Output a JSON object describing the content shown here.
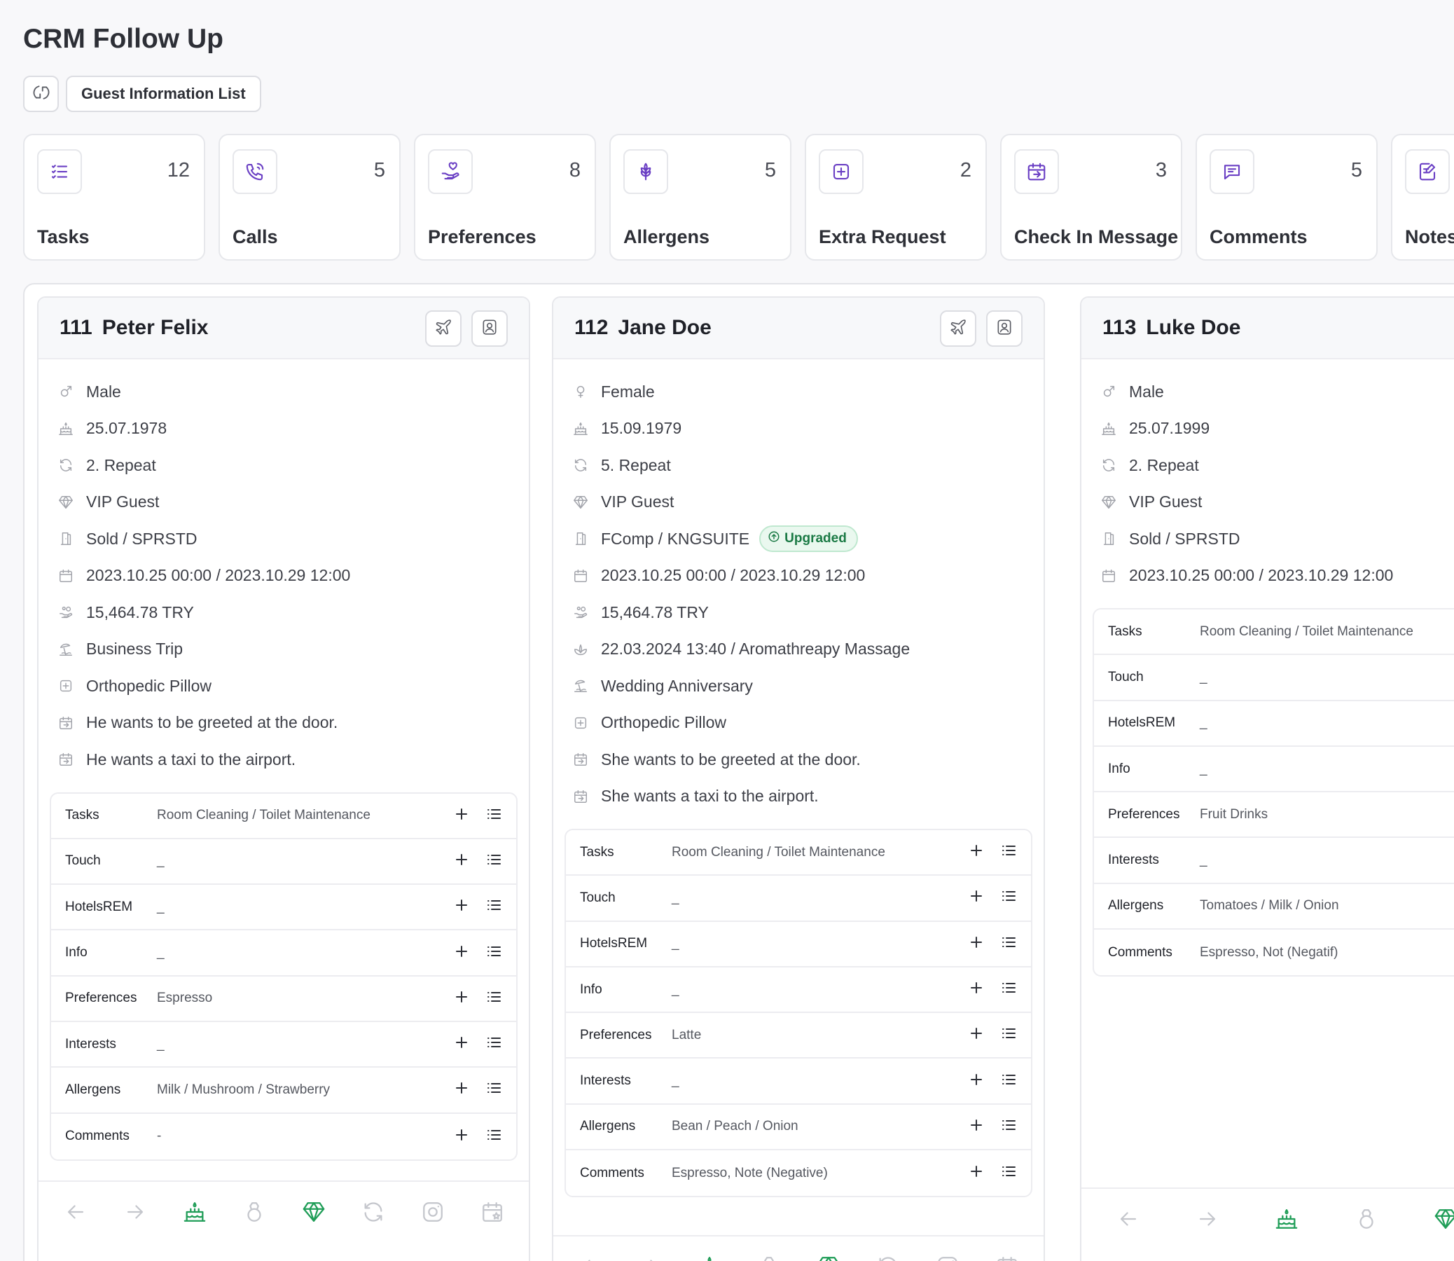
{
  "page": {
    "title": "CRM Follow Up"
  },
  "toolbar": {
    "list_button": "Guest Information List"
  },
  "colors": {
    "accent": "#6a3fc4",
    "green": "#1f9d57",
    "muted_icon": "#a2a4ab"
  },
  "stats": [
    {
      "label": "Tasks",
      "count": "12",
      "icon": "list-icon"
    },
    {
      "label": "Calls",
      "count": "5",
      "icon": "phone-icon"
    },
    {
      "label": "Preferences",
      "count": "8",
      "icon": "hand-heart-icon"
    },
    {
      "label": "Allergens",
      "count": "5",
      "icon": "wheat-icon"
    },
    {
      "label": "Extra Request",
      "count": "2",
      "icon": "plus-square-icon"
    },
    {
      "label": "Check In Message",
      "count": "3",
      "icon": "calendar-arrow-icon"
    },
    {
      "label": "Comments",
      "count": "5",
      "icon": "message-icon"
    },
    {
      "label": "Notes",
      "count": "",
      "icon": "note-edit-icon"
    }
  ],
  "guests": [
    {
      "room": "111",
      "name": "Peter Felix",
      "info": [
        {
          "icon": "male-icon",
          "text": "Male"
        },
        {
          "icon": "cake-icon",
          "text": "25.07.1978"
        },
        {
          "icon": "repeat-icon",
          "text": "2. Repeat"
        },
        {
          "icon": "diamond-icon",
          "text": "VIP Guest"
        },
        {
          "icon": "door-icon",
          "text": "Sold / SPRSTD"
        },
        {
          "icon": "calendar-icon",
          "text": "2023.10.25 00:00 / 2023.10.29 12:00"
        },
        {
          "icon": "money-hand-icon",
          "text": "15,464.78 TRY"
        },
        {
          "icon": "beach-icon",
          "text": "Business Trip"
        },
        {
          "icon": "plus-square-icon",
          "text": "Orthopedic Pillow"
        },
        {
          "icon": "calendar-arrow-icon",
          "text": "He wants to be greeted at the door."
        },
        {
          "icon": "calendar-arrow-icon",
          "text": "He wants a taxi to the airport."
        }
      ],
      "table": [
        {
          "key": "Tasks",
          "value": "Room Cleaning / Toilet Maintenance"
        },
        {
          "key": "Touch",
          "value": "_"
        },
        {
          "key": "HotelsREM",
          "value": "_"
        },
        {
          "key": "Info",
          "value": "_"
        },
        {
          "key": "Preferences",
          "value": "Espresso"
        },
        {
          "key": "Interests",
          "value": "_"
        },
        {
          "key": "Allergens",
          "value": "Milk / Mushroom / Strawberry"
        },
        {
          "key": "Comments",
          "value": "-"
        }
      ]
    },
    {
      "room": "112",
      "name": "Jane Doe",
      "badge": "Upgraded",
      "info": [
        {
          "icon": "female-icon",
          "text": "Female"
        },
        {
          "icon": "cake-icon",
          "text": "15.09.1979"
        },
        {
          "icon": "repeat-icon",
          "text": "5. Repeat"
        },
        {
          "icon": "diamond-icon",
          "text": "VIP Guest"
        },
        {
          "icon": "door-icon",
          "text": "FComp / KNGSUITE"
        },
        {
          "icon": "calendar-icon",
          "text": "2023.10.25 00:00 / 2023.10.29 12:00"
        },
        {
          "icon": "money-hand-icon",
          "text": "15,464.78 TRY"
        },
        {
          "icon": "spa-icon",
          "text": "22.03.2024 13:40 / Aromathreapy Massage"
        },
        {
          "icon": "beach-icon",
          "text": "Wedding Anniversary"
        },
        {
          "icon": "plus-square-icon",
          "text": "Orthopedic Pillow"
        },
        {
          "icon": "calendar-arrow-icon",
          "text": "She wants to be greeted at the door."
        },
        {
          "icon": "calendar-arrow-icon",
          "text": "She wants a taxi to the airport."
        }
      ],
      "table": [
        {
          "key": "Tasks",
          "value": "Room Cleaning / Toilet Maintenance"
        },
        {
          "key": "Touch",
          "value": "_"
        },
        {
          "key": "HotelsREM",
          "value": "_"
        },
        {
          "key": "Info",
          "value": "_"
        },
        {
          "key": "Preferences",
          "value": "Latte"
        },
        {
          "key": "Interests",
          "value": "_"
        },
        {
          "key": "Allergens",
          "value": "Bean / Peach / Onion"
        },
        {
          "key": "Comments",
          "value": "Espresso, Note (Negative)"
        }
      ]
    },
    {
      "room": "113",
      "name": "Luke Doe",
      "info": [
        {
          "icon": "male-icon",
          "text": "Male"
        },
        {
          "icon": "cake-icon",
          "text": "25.07.1999"
        },
        {
          "icon": "repeat-icon",
          "text": "2. Repeat"
        },
        {
          "icon": "diamond-icon",
          "text": "VIP Guest"
        },
        {
          "icon": "door-icon",
          "text": "Sold / SPRSTD"
        },
        {
          "icon": "calendar-icon",
          "text": "2023.10.25 00:00 / 2023.10.29 12:00"
        }
      ],
      "table": [
        {
          "key": "Tasks",
          "value": "Room Cleaning / Toilet Maintenance"
        },
        {
          "key": "Touch",
          "value": "_"
        },
        {
          "key": "HotelsREM",
          "value": "_"
        },
        {
          "key": "Info",
          "value": "_"
        },
        {
          "key": "Preferences",
          "value": "Fruit Drinks"
        },
        {
          "key": "Interests",
          "value": "_"
        },
        {
          "key": "Allergens",
          "value": "Tomatoes / Milk / Onion"
        },
        {
          "key": "Comments",
          "value": "Espresso, Not (Negatif)"
        }
      ]
    }
  ],
  "footer_icons": [
    "arrow-left-icon",
    "arrow-right-icon",
    "cake-icon",
    "ring-icon",
    "diamond-icon",
    "repeat-icon",
    "instagram-icon",
    "calendar-star-icon"
  ]
}
